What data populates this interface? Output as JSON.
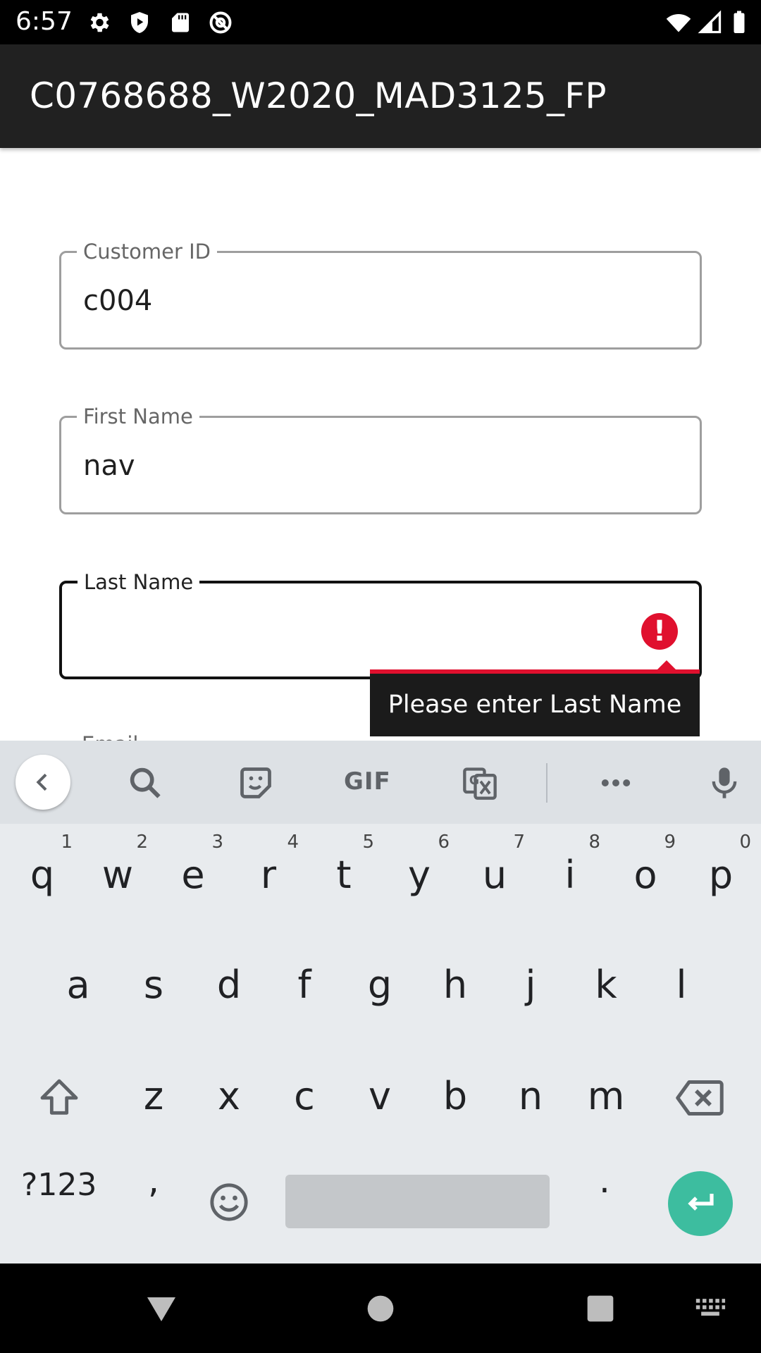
{
  "status_bar": {
    "time": "6:57",
    "left_icons": [
      "gear-icon",
      "shield-play-icon",
      "sd-card-icon",
      "at-sign-icon"
    ],
    "right_icons": [
      "wifi-icon",
      "signal-icon",
      "battery-icon"
    ]
  },
  "app_bar": {
    "title": "C0768688_W2020_MAD3125_FP"
  },
  "form": {
    "customer_id": {
      "label": "Customer ID",
      "value": "c004"
    },
    "first_name": {
      "label": "First Name",
      "value": "nav"
    },
    "last_name": {
      "label": "Last Name",
      "value": "",
      "error": "Please enter Last Name"
    },
    "email": {
      "label": "Email"
    }
  },
  "keyboard": {
    "toolbar": {
      "gif_label": "GIF"
    },
    "row1": [
      {
        "k": "q",
        "n": "1"
      },
      {
        "k": "w",
        "n": "2"
      },
      {
        "k": "e",
        "n": "3"
      },
      {
        "k": "r",
        "n": "4"
      },
      {
        "k": "t",
        "n": "5"
      },
      {
        "k": "y",
        "n": "6"
      },
      {
        "k": "u",
        "n": "7"
      },
      {
        "k": "i",
        "n": "8"
      },
      {
        "k": "o",
        "n": "9"
      },
      {
        "k": "p",
        "n": "0"
      }
    ],
    "row2": [
      "a",
      "s",
      "d",
      "f",
      "g",
      "h",
      "j",
      "k",
      "l"
    ],
    "row3": [
      "z",
      "x",
      "c",
      "v",
      "b",
      "n",
      "m"
    ],
    "symbols_label": "?123",
    "comma": ",",
    "period": "."
  },
  "colors": {
    "app_bar": "#212121",
    "error": "#e0102e",
    "enter_key": "#3dbd9f",
    "keyboard_bg": "#e8ebee"
  }
}
